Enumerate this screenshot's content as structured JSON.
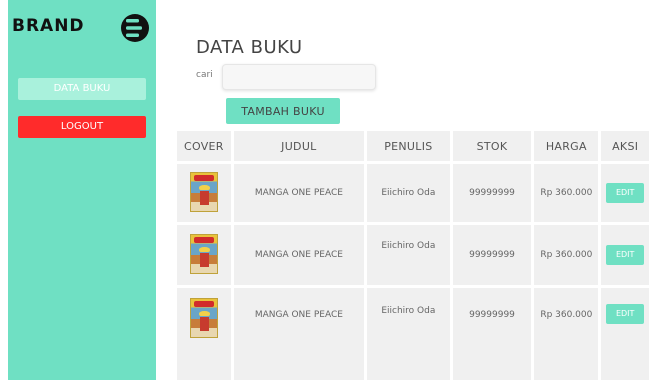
{
  "sidebar": {
    "brand": "BRAND",
    "logo_icon": "hamburger-logo-icon",
    "nav_data_buku": "DATA BUKU",
    "nav_logout": "LOGOUT"
  },
  "main": {
    "title": "DATA BUKU",
    "search_label": "cari",
    "search_value": "",
    "add_button": "TAMBAH BUKU"
  },
  "table": {
    "headers": [
      "COVER",
      "JUDUL",
      "PENULIS",
      "STOK",
      "HARGA",
      "AKSI"
    ],
    "rows": [
      {
        "cover_icon": "one-piece-cover-icon",
        "judul": "MANGA ONE PEACE",
        "penulis": "Eiichiro Oda",
        "stok": "99999999",
        "harga": "Rp 360.000",
        "aksi": "EDIT"
      },
      {
        "cover_icon": "one-piece-cover-icon",
        "judul": "MANGA ONE PEACE",
        "penulis": "Eiichiro Oda",
        "stok": "99999999",
        "harga": "Rp 360.000",
        "aksi": "EDIT"
      },
      {
        "cover_icon": "one-piece-cover-icon",
        "judul": "MANGA ONE PEACE",
        "penulis": "Eiichiro Oda",
        "stok": "99999999",
        "harga": "Rp 360.000",
        "aksi": "EDIT"
      }
    ]
  },
  "colors": {
    "accent": "#6fe0c3",
    "logout": "#ff2b2b",
    "cell_bg": "#f0f0f0"
  }
}
